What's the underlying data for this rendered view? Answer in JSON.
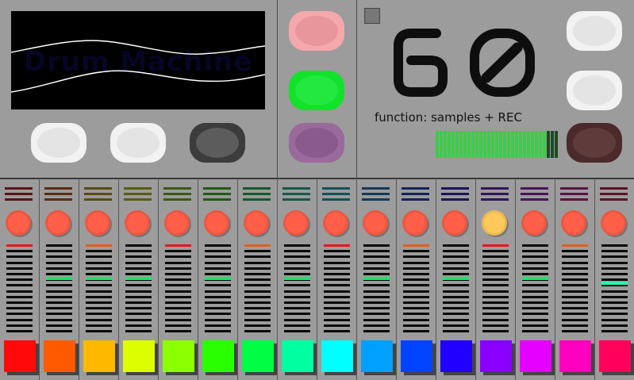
{
  "screen": {
    "title": "Drum Machine"
  },
  "bpm": {
    "value": "60"
  },
  "function_label": "function: samples + REC",
  "pads_left": [
    {
      "name": "pad-left-1",
      "bg": "#f2f2f2",
      "inner": "#e4e4e4"
    },
    {
      "name": "pad-left-2",
      "bg": "#f2f2f2",
      "inner": "#e4e4e4"
    },
    {
      "name": "pad-left-3",
      "bg": "#3c3c3c",
      "inner": "#5c5c5c"
    }
  ],
  "pads_mid": [
    {
      "name": "pad-mid-pink",
      "bg": "#f4a8ac",
      "inner": "#e8959b"
    },
    {
      "name": "pad-mid-green",
      "bg": "#12e22a",
      "inner": "#22e840"
    },
    {
      "name": "pad-mid-purple",
      "bg": "#9a6a9c",
      "inner": "#8a5a8c"
    }
  ],
  "pads_right": [
    {
      "name": "pad-right-1",
      "bg": "#f2f2f2",
      "inner": "#e4e4e4"
    },
    {
      "name": "pad-right-2",
      "bg": "#f2f2f2",
      "inner": "#e4e4e4"
    },
    {
      "name": "pad-right-3",
      "bg": "#4a2a2a",
      "inner": "#5e3c3c"
    }
  ],
  "level_meter": {
    "active_segments": 28,
    "total_segments": 31,
    "active_color": "#3ccc48",
    "inactive_color": "#1c4a24"
  },
  "channels": [
    {
      "color": "#ff0a0a",
      "led": "#5a1414",
      "knob": "#ff5f48",
      "marker": "#e01b1b",
      "level": 0.0
    },
    {
      "color": "#ff5a00",
      "led": "#5a2e14",
      "knob": "#ff5f48",
      "marker": null,
      "level": 0.45
    },
    {
      "color": "#ffb800",
      "led": "#5a4a14",
      "knob": "#ff5f48",
      "marker": "#e0601b",
      "level": 0.45
    },
    {
      "color": "#dcff00",
      "led": "#5a5a14",
      "knob": "#ff5f48",
      "marker": null,
      "level": 0.45
    },
    {
      "color": "#8cff00",
      "led": "#3a5a14",
      "knob": "#ff5f48",
      "marker": "#e01b1b",
      "level": 0.0
    },
    {
      "color": "#2aff00",
      "led": "#1e5a14",
      "knob": "#ff5f48",
      "marker": null,
      "level": 0.45
    },
    {
      "color": "#00ff44",
      "led": "#145a2e",
      "knob": "#ff5f48",
      "marker": "#e0601b",
      "level": 0.0
    },
    {
      "color": "#00ffa0",
      "led": "#145a4a",
      "knob": "#ff5f48",
      "marker": null,
      "level": 0.45
    },
    {
      "color": "#00ffff",
      "led": "#14505a",
      "knob": "#ff5f48",
      "marker": "#e01b1b",
      "level": 0.0
    },
    {
      "color": "#00a0ff",
      "led": "#143a5a",
      "knob": "#ff5f48",
      "marker": null,
      "level": 0.45
    },
    {
      "color": "#0044ff",
      "led": "#14245a",
      "knob": "#ff5f48",
      "marker": "#e0601b",
      "level": 0.0
    },
    {
      "color": "#2200ff",
      "led": "#1a145a",
      "knob": "#ff5f48",
      "marker": null,
      "level": 0.45
    },
    {
      "color": "#8a00ff",
      "led": "#34145a",
      "knob": "#ffc85a",
      "marker": "#e01b1b",
      "level": 0.0
    },
    {
      "color": "#e400ff",
      "led": "#4a145a",
      "knob": "#ff5f48",
      "marker": null,
      "level": 0.45
    },
    {
      "color": "#ff00c0",
      "led": "#5a1446",
      "knob": "#ff5f48",
      "marker": "#e0601b",
      "level": 0.0
    },
    {
      "color": "#ff005a",
      "led": "#5a1428",
      "knob": "#ff5f48",
      "marker": null,
      "level": 0.53
    }
  ],
  "colors": {
    "background": "#9c9c9c",
    "fader_highlight": "#1fe06a",
    "fader_highlight_last": "#2ef0b0"
  }
}
